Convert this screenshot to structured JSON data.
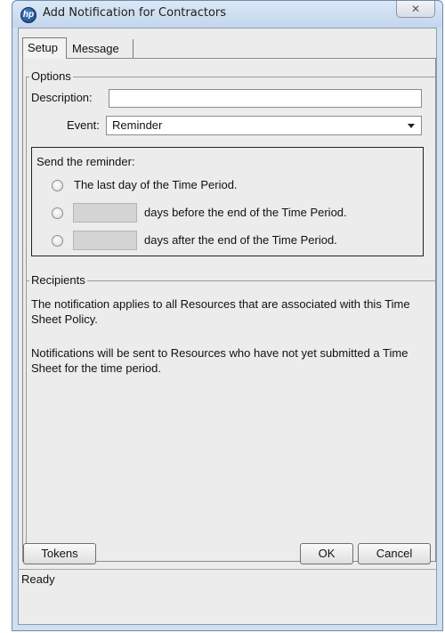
{
  "window": {
    "title": "Add Notification for Contractors",
    "close_glyph": "✕",
    "app_icon_glyph": "hp"
  },
  "tabs": [
    {
      "label": "Setup",
      "selected": true
    },
    {
      "label": "Message",
      "selected": false
    }
  ],
  "options": {
    "group_label": "Options",
    "description_label": "Description:",
    "description_value": "",
    "event_label": "Event:",
    "event_value": "Reminder"
  },
  "reminder": {
    "heading": "Send the reminder:",
    "options": [
      {
        "label": "The last day of the Time Period.",
        "selected": false
      },
      {
        "label": "days before the end of the Time Period.",
        "selected": false,
        "days_value": ""
      },
      {
        "label": "days after the end of the Time Period.",
        "selected": false,
        "days_value": ""
      }
    ]
  },
  "recipients": {
    "group_label": "Recipients",
    "paragraph1": "The notification applies to all Resources that are associated with this Time Sheet Policy.",
    "paragraph2": "Notifications will be sent to Resources who have not yet submitted a Time Sheet for the time period."
  },
  "buttons": {
    "tokens": "Tokens",
    "ok": "OK",
    "cancel": "Cancel"
  },
  "status": "Ready"
}
